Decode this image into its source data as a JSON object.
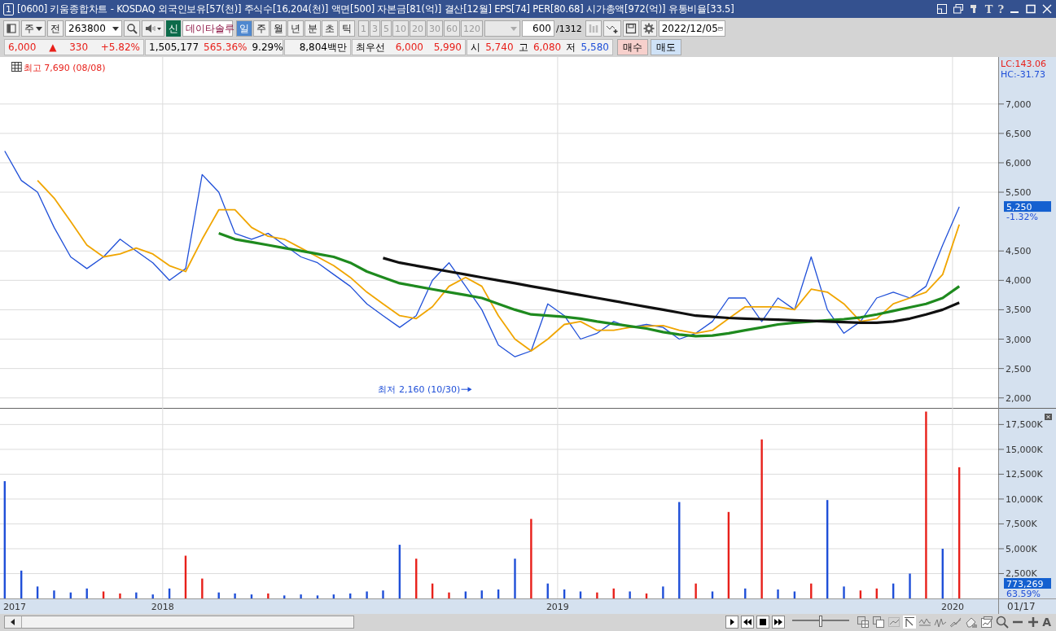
{
  "window": {
    "badge": "1",
    "title": "[0600] 키움종합차트 - KOSDAQ 외국인보유[57(천)] 주식수[16,204(천)] 액면[500] 자본금[81(억)] 결산[12월] EPS[74] PER[80.68] 시가총액[972(억)] 유통비율[33.5]",
    "font_button": "T",
    "help_button": "?"
  },
  "toolbar": {
    "market": "주",
    "jeon": "전",
    "code": "263800",
    "new_badge": "신",
    "stock_name": "데이타솔루",
    "periods": [
      {
        "label": "일",
        "selected": true
      },
      {
        "label": "주",
        "selected": false
      },
      {
        "label": "월",
        "selected": false
      },
      {
        "label": "년",
        "selected": false
      },
      {
        "label": "분",
        "selected": false
      },
      {
        "label": "초",
        "selected": false
      },
      {
        "label": "틱",
        "selected": false
      }
    ],
    "intervals": [
      {
        "label": "1",
        "disabled": true
      },
      {
        "label": "3",
        "disabled": true
      },
      {
        "label": "5",
        "disabled": true
      },
      {
        "label": "10",
        "disabled": true
      },
      {
        "label": "20",
        "disabled": true
      },
      {
        "label": "30",
        "disabled": true
      },
      {
        "label": "60",
        "disabled": true
      },
      {
        "label": "120",
        "disabled": true
      }
    ],
    "count": "600",
    "total": "/1312",
    "date": "2022/12/05"
  },
  "quote_groups": [
    [
      {
        "text": "6,000",
        "color": "#e8201a"
      },
      {
        "text": "▲",
        "color": "#e8201a"
      },
      {
        "text": "330",
        "color": "#e8201a"
      },
      {
        "text": "+5.82%",
        "color": "#e8201a"
      }
    ],
    [
      {
        "text": "1,505,177"
      },
      {
        "text": "565.36%",
        "color": "#e8201a"
      },
      {
        "text": "9.29%"
      }
    ],
    [
      {
        "text": "8,804백만"
      }
    ],
    [
      {
        "text": "최우선"
      },
      {
        "text": "6,000",
        "color": "#e8201a"
      },
      {
        "text": "5,990",
        "color": "#e8201a"
      }
    ],
    [
      {
        "text": "시"
      },
      {
        "text": "5,740",
        "color": "#e8201a"
      },
      {
        "text": "고"
      },
      {
        "text": "6,080",
        "color": "#e8201a"
      },
      {
        "text": "저"
      },
      {
        "text": "5,580",
        "color": "#1f4fd8"
      }
    ]
  ],
  "buy_button": "매수",
  "sell_button": "매도",
  "price_chart": {
    "lc": "LC:143.06",
    "hc": "HC:-31.73",
    "current": "5,250",
    "change": "-1.32%",
    "chart_data": {
      "type": "line",
      "x": [
        2017.6,
        2017.642,
        2017.683,
        2017.725,
        2017.767,
        2017.808,
        2017.85,
        2017.892,
        2017.933,
        2017.975,
        2018.017,
        2018.058,
        2018.1,
        2018.142,
        2018.183,
        2018.225,
        2018.267,
        2018.308,
        2018.35,
        2018.392,
        2018.433,
        2018.475,
        2018.517,
        2018.558,
        2018.6,
        2018.642,
        2018.683,
        2018.725,
        2018.767,
        2018.808,
        2018.85,
        2018.892,
        2018.933,
        2018.975,
        2019.017,
        2019.058,
        2019.1,
        2019.142,
        2019.183,
        2019.225,
        2019.267,
        2019.308,
        2019.35,
        2019.392,
        2019.433,
        2019.475,
        2019.517,
        2019.558,
        2019.6,
        2019.642,
        2019.683,
        2019.725,
        2019.767,
        2019.808,
        2019.85,
        2019.892,
        2019.933,
        2019.975,
        2020.017
      ],
      "series": [
        {
          "color": "#1f4fd8",
          "values": [
            6200,
            5700,
            5500,
            4900,
            4400,
            4200,
            4400,
            4700,
            4500,
            4300,
            4000,
            4200,
            5800,
            5500,
            4800,
            4700,
            4800,
            4600,
            4400,
            4300,
            4100,
            3900,
            3600,
            3400,
            3200,
            3400,
            4000,
            4300,
            3900,
            3500,
            2900,
            2700,
            2800,
            3600,
            3400,
            3000,
            3100,
            3300,
            3200,
            3250,
            3200,
            3000,
            3100,
            3300,
            3700,
            3700,
            3300,
            3700,
            3500,
            4400,
            3500,
            3100,
            3300,
            3700,
            3800,
            3700,
            3900,
            4600,
            5250
          ]
        },
        {
          "color": "#f0a500",
          "values": [
            null,
            null,
            5700,
            5400,
            5000,
            4600,
            4400,
            4450,
            4550,
            4450,
            4250,
            4150,
            4700,
            5200,
            5200,
            4900,
            4750,
            4700,
            4550,
            4400,
            4250,
            4050,
            3800,
            3600,
            3400,
            3350,
            3550,
            3900,
            4050,
            3900,
            3400,
            3000,
            2800,
            3000,
            3250,
            3300,
            3150,
            3150,
            3200,
            3220,
            3230,
            3150,
            3100,
            3150,
            3350,
            3550,
            3550,
            3550,
            3500,
            3850,
            3800,
            3600,
            3300,
            3350,
            3600,
            3700,
            3800,
            4100,
            4950
          ]
        },
        {
          "color": "#1e8a1e",
          "values": [
            null,
            null,
            null,
            null,
            null,
            null,
            null,
            null,
            null,
            null,
            null,
            null,
            null,
            4800,
            4700,
            4650,
            4600,
            4550,
            4500,
            4450,
            4400,
            4300,
            4150,
            4050,
            3950,
            3900,
            3850,
            3800,
            3750,
            3700,
            3600,
            3500,
            3420,
            3400,
            3380,
            3350,
            3300,
            3260,
            3220,
            3180,
            3120,
            3080,
            3050,
            3060,
            3100,
            3150,
            3200,
            3250,
            3280,
            3300,
            3320,
            3340,
            3370,
            3420,
            3480,
            3540,
            3600,
            3700,
            3900
          ]
        },
        {
          "color": "#101010",
          "values": [
            null,
            null,
            null,
            null,
            null,
            null,
            null,
            null,
            null,
            null,
            null,
            null,
            null,
            null,
            null,
            null,
            null,
            null,
            null,
            null,
            null,
            null,
            null,
            4380,
            4300,
            4250,
            4200,
            4150,
            4100,
            4050,
            4000,
            3950,
            3900,
            3850,
            3800,
            3750,
            3700,
            3650,
            3600,
            3550,
            3500,
            3450,
            3400,
            3380,
            3360,
            3350,
            3340,
            3330,
            3320,
            3310,
            3300,
            3290,
            3280,
            3280,
            3300,
            3350,
            3420,
            3500,
            3620
          ]
        }
      ],
      "ylim": [
        1830,
        7800
      ],
      "xlim": [
        2017.588,
        2020.262
      ],
      "yticks": [
        {
          "value": 2000,
          "label": "2,000"
        },
        {
          "value": 2500,
          "label": "2,500"
        },
        {
          "value": 3000,
          "label": "3,000"
        },
        {
          "value": 3500,
          "label": "3,500"
        },
        {
          "value": 4000,
          "label": "4,000"
        },
        {
          "value": 4500,
          "label": "4,500"
        },
        {
          "value": 5500,
          "label": "5,500"
        },
        {
          "value": 6000,
          "label": "6,000"
        },
        {
          "value": 6500,
          "label": "6,500"
        },
        {
          "value": 7000,
          "label": "7,000"
        }
      ],
      "grid": true,
      "annotations": [
        "최고 7,690 (08/08)",
        "최저 2,160 (10/30)"
      ]
    }
  },
  "volume_chart": {
    "current": "773,269",
    "ratio": "63.59%",
    "axis_start": "2017",
    "chart_data": {
      "type": "bar",
      "x": [
        2017.6,
        2017.642,
        2017.683,
        2017.725,
        2017.767,
        2017.808,
        2017.85,
        2017.892,
        2017.933,
        2017.975,
        2018.017,
        2018.058,
        2018.1,
        2018.142,
        2018.183,
        2018.225,
        2018.267,
        2018.308,
        2018.35,
        2018.392,
        2018.433,
        2018.475,
        2018.517,
        2018.558,
        2018.6,
        2018.642,
        2018.683,
        2018.725,
        2018.767,
        2018.808,
        2018.85,
        2018.892,
        2018.933,
        2018.975,
        2019.017,
        2019.058,
        2019.1,
        2019.142,
        2019.183,
        2019.225,
        2019.267,
        2019.308,
        2019.35,
        2019.392,
        2019.433,
        2019.475,
        2019.517,
        2019.558,
        2019.6,
        2019.642,
        2019.683,
        2019.725,
        2019.767,
        2019.808,
        2019.85,
        2019.892,
        2019.933,
        2019.975,
        2020.017
      ],
      "series": [
        {
          "color": "#1f4fd8",
          "values": [
            11800,
            2800,
            1200,
            800,
            600,
            1000,
            0,
            0,
            600,
            400,
            1000,
            0,
            0,
            600,
            500,
            400,
            0,
            300,
            400,
            300,
            400,
            500,
            700,
            800,
            5400,
            0,
            0,
            0,
            700,
            800,
            900,
            4000,
            0,
            1500,
            900,
            700,
            0,
            0,
            700,
            0,
            1200,
            9700,
            0,
            700,
            0,
            1000,
            0,
            900,
            700,
            0,
            9900,
            1200,
            0,
            0,
            1500,
            2500,
            0,
            5000,
            0
          ]
        },
        {
          "color": "#e8201a",
          "values": [
            0,
            0,
            0,
            0,
            0,
            0,
            700,
            500,
            0,
            0,
            0,
            4300,
            2000,
            0,
            0,
            0,
            500,
            0,
            0,
            0,
            0,
            0,
            0,
            0,
            0,
            4000,
            1500,
            600,
            0,
            0,
            0,
            0,
            8000,
            0,
            0,
            0,
            600,
            1000,
            0,
            500,
            0,
            0,
            1500,
            0,
            8700,
            0,
            16000,
            0,
            0,
            1500,
            0,
            0,
            800,
            1000,
            0,
            0,
            18800,
            0,
            13200
          ]
        }
      ],
      "ylim": [
        0,
        19170
      ],
      "xlim": [
        2017.588,
        2020.262
      ],
      "xticks": [
        {
          "value": 2018,
          "label": "2018"
        },
        {
          "value": 2019,
          "label": "2019"
        },
        {
          "value": 2020,
          "label": "2020"
        }
      ],
      "yticks": [
        {
          "value": 2500,
          "label": "2,500K"
        },
        {
          "value": 5000,
          "label": "5,000K"
        },
        {
          "value": 7500,
          "label": "7,500K"
        },
        {
          "value": 10000,
          "label": "10,000K"
        },
        {
          "value": 12500,
          "label": "12,500K"
        },
        {
          "value": 15000,
          "label": "15,000K"
        },
        {
          "value": 17500,
          "label": "17,500K"
        }
      ],
      "grid": true
    }
  },
  "cursor_date": "01/17",
  "zoom_slider": {
    "level": 0.5
  },
  "zoom_font_button": "A"
}
